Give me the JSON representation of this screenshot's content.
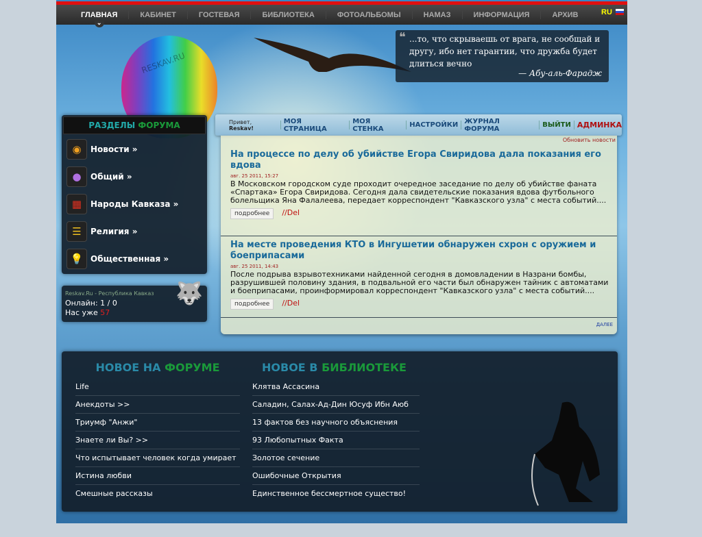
{
  "nav": {
    "items": [
      "ГЛАВНАЯ",
      "КАБИНЕТ",
      "ГОСТЕВАЯ",
      "БИБЛИОТЕКА",
      "ФОТОАЛЬБОМЫ",
      "НАМАЗ",
      "ИНФОРМАЦИЯ",
      "АРХИВ"
    ],
    "lang": "RU"
  },
  "header": {
    "balloon_text": "RESKAV.RU",
    "quote": "...то, что скрываешь от врага, не сообщай и другу, ибо нет гарантии, что дружба будет длиться вечно",
    "quote_author": "— Абу-аль-Фарадж"
  },
  "sections": {
    "title_a": "РАЗДЕЛЫ",
    "title_b": "ФОРУМА",
    "items": [
      "Новости »",
      "Общий »",
      "Народы Кавказа »",
      "Религия »",
      "Общественная »"
    ]
  },
  "online": {
    "site": "Reskav.Ru - Республика Кавказ",
    "online": "Онлайн: 1 / 0",
    "total_label": "Нас уже",
    "total": "57"
  },
  "userbar": {
    "hello": "Привет,",
    "user": "Reskav!",
    "links": [
      "МОЯ СТРАНИЦА",
      "МОЯ СТЕНКА",
      "НАСТРОЙКИ",
      "ЖУРНАЛ ФОРУМА"
    ],
    "logout": "ВЫЙТИ",
    "admin": "АДМИНКА"
  },
  "news": {
    "refresh": "Обновить новости",
    "more": "подробнее",
    "del": "//Del",
    "further": "ДАЛЕЕ",
    "items": [
      {
        "title": "На процессе по делу об убийстве Егора Свиридова дала показания его вдова",
        "date": "авг. 25 2011, 15:27",
        "text": "В Московском городском суде проходит очередное заседание по делу об убийстве фаната «Спартака» Егора Свиридова. Сегодня дала свидетельские показания вдова футбольного болельщика Яна Фалалеева, передает корреспондент \"Кавказского узла\" с места событий...."
      },
      {
        "title": "На месте проведения КТО в Ингушетии обнаружен схрон с оружием и боеприпасами",
        "date": "авг. 25 2011, 14:43",
        "text": "После подрыва взрывотехниками найденной сегодня в домовладении в Назрани бомбы, разрушившей половину здания, в подвальной его части был обнаружен тайник с автоматами и боеприпасами, проинформировал корреспондент \"Кавказского узла\" с места событий...."
      }
    ]
  },
  "forum_new": {
    "title_a": "НОВОЕ НА",
    "title_b": "ФОРУМЕ",
    "items": [
      "Life",
      "Анекдоты   >>",
      "Триумф \"Анжи\"",
      "Знаете ли Вы?   >>",
      "Что испытывает человек когда умирает",
      "Истина любви",
      "Смешные рассказы"
    ]
  },
  "library_new": {
    "title_a": "НОВОЕ В",
    "title_b": "БИБЛИОТЕКЕ",
    "items": [
      "Клятва Ассасина",
      "Саладин, Салах-Ад-Дин Юсуф Ибн Аюб",
      "13 фактов без научного объяснения",
      "93 Любопытных Факта",
      "Золотое сечение",
      "Ошибочные Открытия",
      "Единственное бессмертное существо!"
    ]
  }
}
